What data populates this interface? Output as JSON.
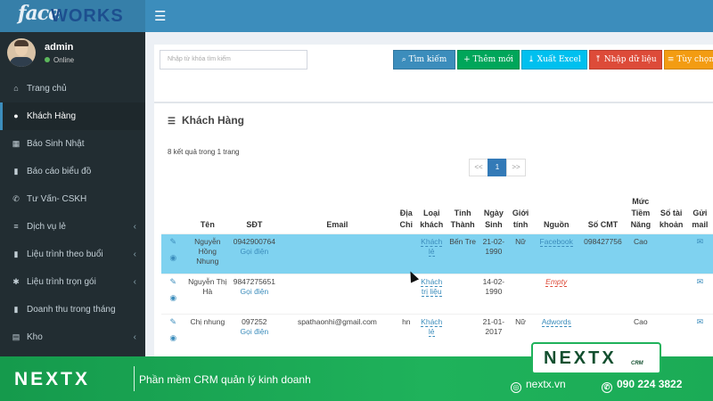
{
  "app": {
    "logo_prefix": "face",
    "logo_suffix": "WORKS",
    "menu_icon": "hamburger-icon"
  },
  "user": {
    "name": "admin",
    "status": "Online"
  },
  "sidebar": {
    "items": [
      {
        "label": "Trang chủ",
        "icon": "home-icon"
      },
      {
        "label": "Khách Hàng",
        "icon": "user-icon",
        "active": true
      },
      {
        "label": "Báo Sinh Nhật",
        "icon": "birthday-icon"
      },
      {
        "label": "Báo cáo biểu đồ",
        "icon": "bar-chart-icon"
      },
      {
        "label": "Tư Vấn- CSKH",
        "icon": "phone-icon"
      },
      {
        "label": "Dịch vụ lẻ",
        "icon": "list-icon",
        "expandable": true
      },
      {
        "label": "Liệu trình theo buổi",
        "icon": "bookmark-icon",
        "expandable": true
      },
      {
        "label": "Liệu trình trọn gói",
        "icon": "asterisk-icon",
        "expandable": true
      },
      {
        "label": "Doanh thu trong tháng",
        "icon": "bar-chart-icon"
      },
      {
        "label": "Kho",
        "icon": "database-icon",
        "expandable": true
      }
    ]
  },
  "toolbar": {
    "search_placeholder": "Nhập từ khóa tìm kiếm",
    "buttons": {
      "search": "Tìm kiếm",
      "add": "Thêm mới",
      "export": "Xuất Excel",
      "import": "Nhập dữ liệu",
      "custom": "Tùy chọn"
    }
  },
  "customers": {
    "title": "Khách Hàng",
    "result_count": "8 kết quả trong 1 trang",
    "pager": {
      "prev": "<<",
      "current": "1",
      "next": ">>"
    },
    "columns": [
      "Tên",
      "SĐT",
      "Email",
      "Địa Chỉ",
      "Loại khách",
      "Tỉnh Thành",
      "Ngày Sinh",
      "Giới tính",
      "Nguồn",
      "Số CMT",
      "Mức Tiềm Năng",
      "Số tài khoản",
      "Gửi mail"
    ],
    "rows": [
      {
        "name": "Nguyễn Hồng Nhung",
        "phone": "0942900764",
        "call": "Gọi điện",
        "email": "",
        "address": "",
        "type": "Khách lẻ",
        "city": "Bến Tre",
        "birth": "21-02-1990",
        "gender": "Nữ",
        "source": "Facebook",
        "cmt": "098427756",
        "potential": "Cao",
        "account": ""
      },
      {
        "name": "Nguyễn Thị Hà",
        "phone": "9847275651",
        "call": "Gọi điện",
        "email": "",
        "address": "",
        "type": "Khách trị liệu",
        "city": "",
        "birth": "14-02-1990",
        "gender": "",
        "source": "Empty",
        "cmt": "",
        "potential": "",
        "account": ""
      },
      {
        "name": "Chị nhung",
        "phone": "097252",
        "call": "Gọi điện",
        "email": "spathaonhi@gmail.com",
        "address": "hn",
        "type": "Khách lẻ",
        "city": "",
        "birth": "21-01-2017",
        "gender": "Nữ",
        "source": "Adwords",
        "cmt": "",
        "potential": "Cao",
        "account": ""
      }
    ]
  },
  "banner": {
    "brand": "NEXTX",
    "slogan": "Phần mềm CRM quản lý kinh doanh",
    "website": "nextx.vn",
    "phone": "090 224 3822",
    "badge": "NEXTX",
    "badge_sub": "CRM"
  },
  "colors": {
    "header": "#3c8dbc",
    "sidebar": "#222d32",
    "highlight_row": "#7fd2f0",
    "banner_green": "#1fb25b"
  }
}
